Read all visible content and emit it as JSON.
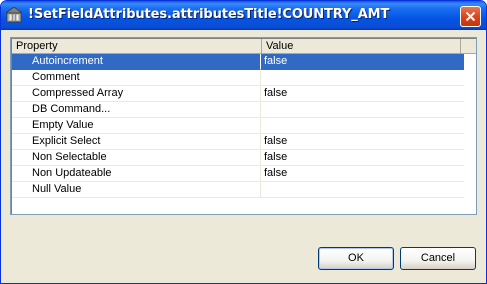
{
  "window": {
    "title": "!SetFieldAttributes.attributesTitle!COUNTRY_AMT"
  },
  "icons": {
    "app": "app-icon",
    "close": "close-icon"
  },
  "grid": {
    "columns": [
      "Property",
      "Value"
    ],
    "rows": [
      {
        "property": "Autoincrement",
        "value": "false",
        "selected": true
      },
      {
        "property": "Comment",
        "value": ""
      },
      {
        "property": "Compressed Array",
        "value": "false"
      },
      {
        "property": "DB Command...",
        "value": ""
      },
      {
        "property": "Empty Value",
        "value": ""
      },
      {
        "property": "Explicit Select",
        "value": "false"
      },
      {
        "property": "Non Selectable",
        "value": "false"
      },
      {
        "property": "Non Updateable",
        "value": "false"
      },
      {
        "property": "Null Value",
        "value": ""
      }
    ]
  },
  "buttons": {
    "ok_label": "OK",
    "cancel_label": "Cancel"
  },
  "colors": {
    "titlebar": "#0554e3",
    "selection": "#316ac5",
    "dialog_bg": "#ece9d8"
  }
}
